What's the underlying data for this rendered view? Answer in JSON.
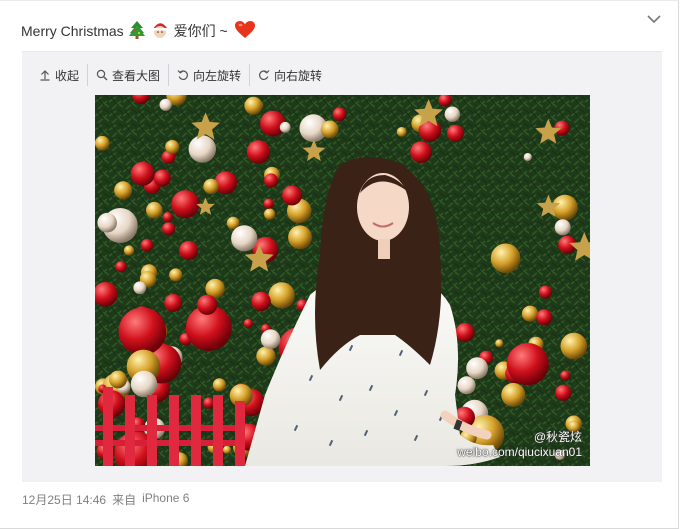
{
  "post": {
    "text": "Merry Christmas",
    "emojis": [
      "christmas-tree-emoji",
      "santa-emoji"
    ],
    "text_after": "爱你们 ~",
    "heart": "red-heart-emoji"
  },
  "toolbar": {
    "collapse_label": "收起",
    "view_large_label": "查看大图",
    "rotate_left_label": "向左旋转",
    "rotate_right_label": "向右旋转"
  },
  "photo": {
    "watermark_user": "@秋瓷炫",
    "watermark_url": "weibo.com/qiucixuan01"
  },
  "meta": {
    "date": "12月25日 14:46",
    "source_prefix": "来自",
    "source": "iPhone 6"
  },
  "colors": {
    "text": "#333333",
    "muted": "#808080",
    "toolbar_bg": "#f2f2f5",
    "heart": "#e8341c"
  }
}
